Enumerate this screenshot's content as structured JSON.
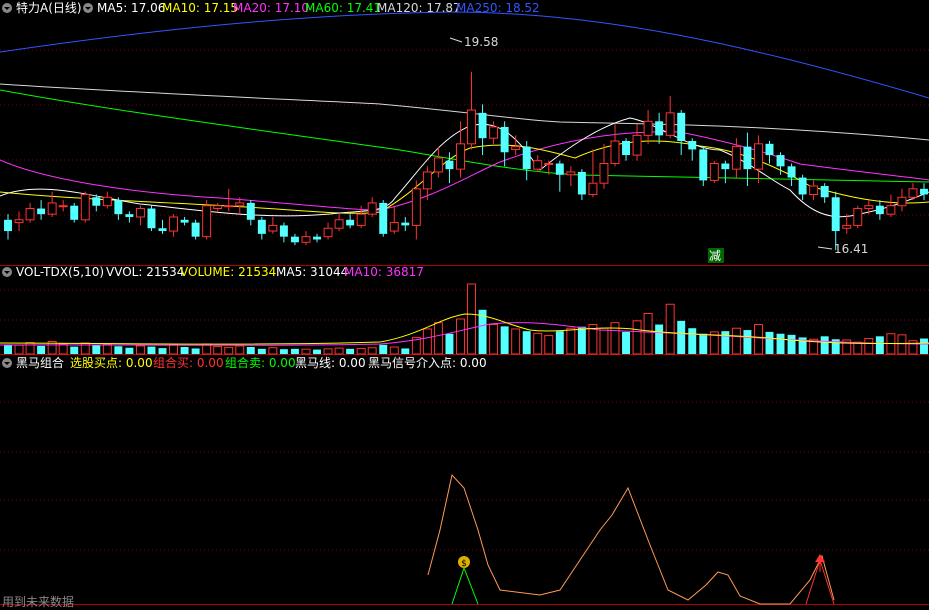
{
  "panels": {
    "price": {
      "title": "特力A(日线)",
      "ma": [
        {
          "label": "MA5: 17.06",
          "color": "#ffffff"
        },
        {
          "label": "MA10: 17.15",
          "color": "#ffff00"
        },
        {
          "label": "MA20: 17.10",
          "color": "#ff33ff"
        },
        {
          "label": "MA60: 17.41",
          "color": "#00ff00"
        },
        {
          "label": "MA120: 17.87",
          "color": "#d8d8d8"
        },
        {
          "label": "MA250: 18.52",
          "color": "#3355ff"
        }
      ],
      "high_label": "19.58",
      "low_label": "16.41",
      "signal_label": "减"
    },
    "volume": {
      "title": "VOL-TDX(5,10)",
      "items": [
        {
          "label": "VVOL: 21534",
          "color": "#ffffff"
        },
        {
          "label": "VOLUME: 21534",
          "color": "#ffff00"
        },
        {
          "label": "MA5: 31044",
          "color": "#ffffff"
        },
        {
          "label": "MA10: 36817",
          "color": "#ff33ff"
        }
      ]
    },
    "indicator": {
      "title": "黑马组合",
      "items": [
        {
          "label": "选股买点: 0.00",
          "color": "#ffff00"
        },
        {
          "label": "组合买: 0.00",
          "color": "#ff3333"
        },
        {
          "label": "组合卖: 0.00",
          "color": "#00ff00"
        },
        {
          "label": "黑马线: 0.00",
          "color": "#ffffff"
        },
        {
          "label": "黑马信号介入点: 0.00",
          "color": "#ffffff"
        }
      ],
      "footer": "用到未来数据"
    }
  },
  "colors": {
    "up": "#ff3333",
    "down": "#54ffff",
    "border": "#b00000",
    "grid": "#800000"
  },
  "chart_data": {
    "type": "candlestick",
    "ylim": [
      16.2,
      20.5
    ],
    "candles": [
      [
        16.95,
        16.75,
        17.05,
        16.6
      ],
      [
        16.9,
        16.95,
        17.1,
        16.75
      ],
      [
        16.95,
        17.15,
        17.25,
        16.9
      ],
      [
        17.15,
        17.05,
        17.3,
        16.95
      ],
      [
        17.05,
        17.25,
        17.45,
        17.0
      ],
      [
        17.2,
        17.2,
        17.3,
        17.1
      ],
      [
        17.2,
        16.95,
        17.25,
        16.9
      ],
      [
        16.95,
        17.4,
        17.45,
        16.9
      ],
      [
        17.35,
        17.2,
        17.4,
        17.1
      ],
      [
        17.2,
        17.35,
        17.45,
        17.15
      ],
      [
        17.3,
        17.05,
        17.35,
        16.95
      ],
      [
        17.05,
        17.0,
        17.1,
        16.9
      ],
      [
        17.0,
        17.15,
        17.2,
        16.85
      ],
      [
        17.15,
        16.8,
        17.2,
        16.75
      ],
      [
        16.8,
        16.75,
        16.95,
        16.7
      ],
      [
        16.75,
        17.0,
        17.05,
        16.65
      ],
      [
        16.95,
        16.9,
        17.0,
        16.85
      ],
      [
        16.9,
        16.65,
        16.95,
        16.6
      ],
      [
        16.65,
        17.2,
        17.3,
        16.6
      ],
      [
        17.15,
        17.2,
        17.25,
        17.1
      ],
      [
        17.2,
        17.2,
        17.5,
        17.1
      ],
      [
        17.2,
        17.25,
        17.35,
        17.05
      ],
      [
        17.25,
        16.95,
        17.3,
        16.85
      ],
      [
        16.95,
        16.7,
        17.0,
        16.6
      ],
      [
        16.75,
        16.85,
        17.0,
        16.7
      ],
      [
        16.85,
        16.65,
        16.9,
        16.55
      ],
      [
        16.65,
        16.55,
        16.7,
        16.5
      ],
      [
        16.55,
        16.65,
        16.75,
        16.5
      ],
      [
        16.65,
        16.6,
        16.7,
        16.55
      ],
      [
        16.65,
        16.8,
        16.9,
        16.6
      ],
      [
        16.8,
        16.95,
        17.05,
        16.75
      ],
      [
        16.95,
        16.85,
        17.05,
        16.8
      ],
      [
        16.85,
        17.05,
        17.2,
        16.8
      ],
      [
        17.05,
        17.25,
        17.35,
        17.0
      ],
      [
        17.25,
        16.7,
        17.3,
        16.65
      ],
      [
        16.75,
        16.9,
        17.2,
        16.7
      ],
      [
        16.9,
        16.85,
        17.0,
        16.75
      ],
      [
        16.85,
        17.5,
        17.65,
        16.6
      ],
      [
        17.5,
        17.8,
        17.9,
        17.3
      ],
      [
        17.8,
        18.05,
        18.25,
        17.7
      ],
      [
        18.0,
        17.85,
        18.15,
        17.6
      ],
      [
        17.85,
        18.3,
        18.7,
        17.7
      ],
      [
        18.3,
        18.9,
        19.58,
        18.2
      ],
      [
        18.85,
        18.4,
        19.0,
        18.1
      ],
      [
        18.4,
        18.6,
        18.7,
        18.3
      ],
      [
        18.6,
        18.15,
        18.7,
        17.9
      ],
      [
        18.2,
        18.25,
        18.45,
        18.1
      ],
      [
        18.25,
        17.85,
        18.35,
        17.65
      ],
      [
        17.85,
        18.0,
        18.1,
        17.8
      ],
      [
        17.95,
        17.95,
        18.0,
        17.75
      ],
      [
        17.95,
        17.75,
        18.0,
        17.45
      ],
      [
        17.75,
        17.8,
        17.9,
        17.55
      ],
      [
        17.8,
        17.4,
        17.85,
        17.3
      ],
      [
        17.4,
        17.6,
        18.2,
        17.35
      ],
      [
        17.6,
        17.95,
        18.3,
        17.5
      ],
      [
        17.95,
        18.35,
        18.65,
        17.9
      ],
      [
        18.35,
        18.1,
        18.4,
        18.0
      ],
      [
        18.1,
        18.45,
        18.65,
        18.0
      ],
      [
        18.45,
        18.7,
        18.9,
        18.3
      ],
      [
        18.7,
        18.45,
        18.85,
        18.3
      ],
      [
        18.45,
        18.85,
        19.15,
        18.4
      ],
      [
        18.85,
        18.35,
        18.9,
        18.1
      ],
      [
        18.35,
        18.2,
        18.4,
        18.0
      ],
      [
        18.2,
        17.65,
        18.25,
        17.55
      ],
      [
        17.65,
        17.95,
        18.0,
        17.6
      ],
      [
        17.95,
        17.85,
        18.0,
        17.6
      ],
      [
        17.85,
        18.25,
        18.4,
        17.7
      ],
      [
        18.25,
        17.85,
        18.5,
        17.55
      ],
      [
        17.85,
        18.3,
        18.45,
        17.6
      ],
      [
        18.3,
        18.1,
        18.35,
        17.95
      ],
      [
        18.1,
        17.9,
        18.15,
        17.75
      ],
      [
        17.9,
        17.7,
        17.95,
        17.55
      ],
      [
        17.7,
        17.4,
        17.75,
        17.3
      ],
      [
        17.4,
        17.55,
        17.65,
        17.3
      ],
      [
        17.55,
        17.35,
        17.6,
        17.25
      ],
      [
        17.35,
        16.75,
        17.45,
        16.41
      ],
      [
        16.8,
        16.85,
        17.05,
        16.7
      ],
      [
        16.85,
        17.15,
        17.2,
        16.8
      ],
      [
        17.15,
        17.2,
        17.3,
        17.05
      ],
      [
        17.2,
        17.05,
        17.3,
        16.95
      ],
      [
        17.05,
        17.2,
        17.4,
        17.0
      ],
      [
        17.2,
        17.35,
        17.5,
        17.1
      ],
      [
        17.35,
        17.5,
        17.6,
        17.3
      ],
      [
        17.5,
        17.4,
        17.6,
        17.3
      ]
    ],
    "volume": [
      26,
      24,
      31,
      22,
      34,
      27,
      20,
      30,
      24,
      27,
      21,
      17,
      22,
      20,
      16,
      25,
      19,
      15,
      27,
      20,
      18,
      22,
      19,
      14,
      17,
      13,
      14,
      13,
      12,
      14,
      16,
      14,
      15,
      17,
      25,
      19,
      15,
      45,
      68,
      85,
      55,
      95,
      190,
      120,
      80,
      75,
      68,
      62,
      56,
      50,
      62,
      70,
      74,
      80,
      70,
      85,
      60,
      90,
      110,
      80,
      135,
      90,
      70,
      55,
      60,
      62,
      70,
      65,
      80,
      60,
      55,
      52,
      45,
      40,
      48,
      40,
      38,
      32,
      42,
      48,
      55,
      52,
      36,
      42
    ],
    "indicator_line": [
      [
        428,
        575
      ],
      [
        440,
        530
      ],
      [
        452,
        475
      ],
      [
        464,
        488
      ],
      [
        478,
        530
      ],
      [
        488,
        565
      ],
      [
        500,
        590
      ],
      [
        540,
        595
      ],
      [
        560,
        590
      ],
      [
        580,
        560
      ],
      [
        600,
        530
      ],
      [
        612,
        515
      ],
      [
        628,
        488
      ],
      [
        650,
        545
      ],
      [
        668,
        590
      ],
      [
        688,
        600
      ],
      [
        706,
        585
      ],
      [
        718,
        572
      ],
      [
        728,
        575
      ],
      [
        740,
        596
      ],
      [
        760,
        604
      ],
      [
        790,
        604
      ],
      [
        810,
        580
      ],
      [
        822,
        556
      ],
      [
        834,
        600
      ]
    ]
  }
}
